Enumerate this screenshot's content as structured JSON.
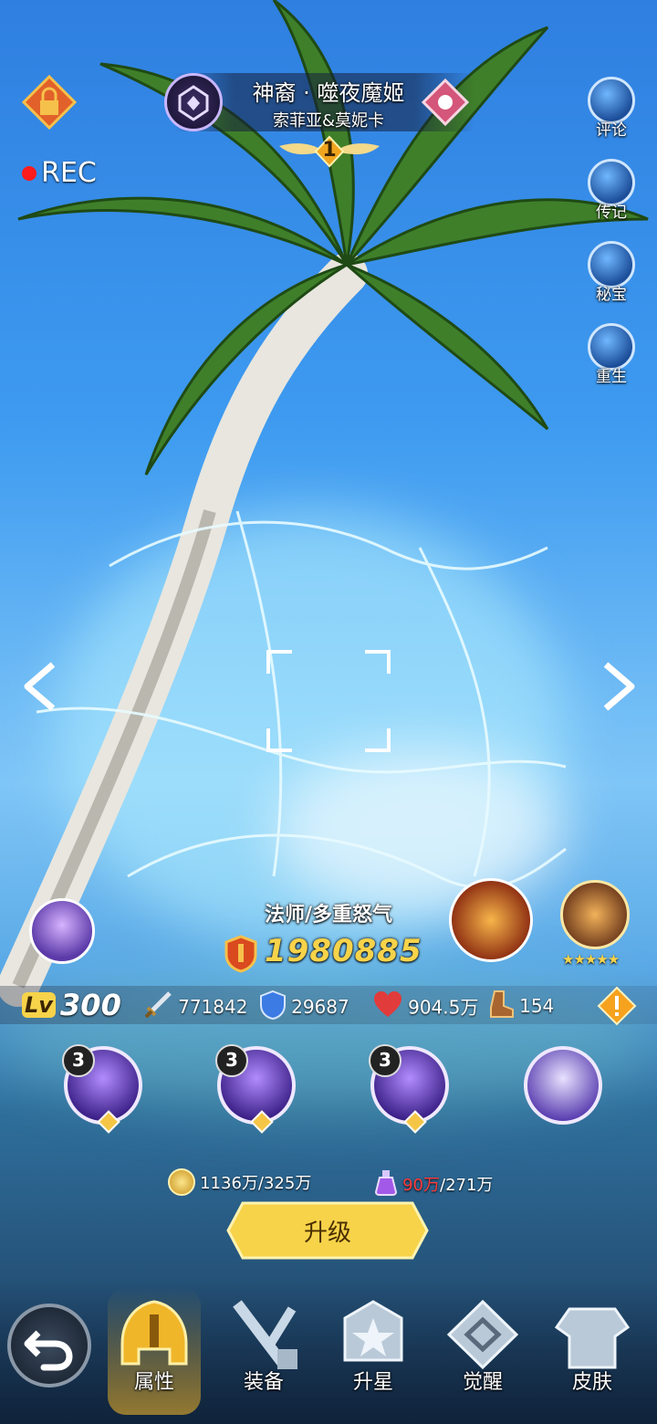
{
  "header": {
    "hero_title": "神裔 · 噬夜魔姬",
    "hero_subtitle": "索菲亚&莫妮卡",
    "rank_badge": "1",
    "rec_label": "REC"
  },
  "side_menu": [
    {
      "label": "评论",
      "icon": "cards-icon"
    },
    {
      "label": "传记",
      "icon": "scroll-icon"
    },
    {
      "label": "秘宝",
      "icon": "treasure-icon"
    },
    {
      "label": "重生",
      "icon": "rebirth-icon"
    }
  ],
  "hero": {
    "class": "法师/多重怒气",
    "power": "1980885",
    "level_prefix": "Lv",
    "level": "300",
    "relic_stars": "★★★★★"
  },
  "stats": {
    "attack": "771842",
    "defense": "29687",
    "hp": "904.5万",
    "speed": "154"
  },
  "skills": [
    {
      "level": "3"
    },
    {
      "level": "3"
    },
    {
      "level": "3"
    },
    {
      "level": ""
    }
  ],
  "costs": {
    "gold": "1136万/325万",
    "potion_have": "90万",
    "potion_need": "/271万"
  },
  "upgrade_label": "升级",
  "bottom_nav": [
    {
      "label": "属性",
      "active": true
    },
    {
      "label": "装备",
      "active": false
    },
    {
      "label": "升星",
      "active": false
    },
    {
      "label": "觉醒",
      "active": false
    },
    {
      "label": "皮肤",
      "active": false
    }
  ],
  "colors": {
    "accent_gold": "#f7d34a",
    "hp_red": "#e23b3b",
    "potion_have_red": "#ff3b3b"
  }
}
